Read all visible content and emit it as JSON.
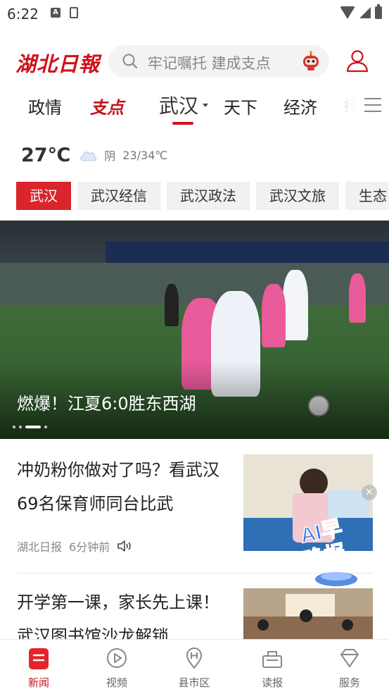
{
  "status_bar": {
    "time": "6:22"
  },
  "header": {
    "logo": "湖北日報",
    "search_placeholder": "牢记嘱托 建成支点"
  },
  "channels": {
    "items": [
      "政情",
      "支点",
      "武汉",
      "天下",
      "经济",
      "抖"
    ],
    "active": "武汉"
  },
  "weather": {
    "temperature": "27℃",
    "condition": "阴",
    "range": "23/34℃"
  },
  "subtabs": {
    "items": [
      "武汉",
      "武汉经信",
      "武汉政法",
      "武汉文旅",
      "生态"
    ],
    "active": "武汉"
  },
  "hero": {
    "title": "燃爆！江夏6:0胜东西湖",
    "slide_count": 4,
    "active_slide": 3
  },
  "news": [
    {
      "title": "冲奶粉你做对了吗？看武汉69名保育师同台比武",
      "source": "湖北日报",
      "time": "6分钟前"
    },
    {
      "title": "开学第一课，家长先上课！武汉图书馆沙龙解锁"
    }
  ],
  "ai_badge": {
    "text": "AI早晚报"
  },
  "tabbar": {
    "items": [
      "新闻",
      "视频",
      "县市区",
      "读报",
      "服务"
    ],
    "active": "新闻"
  },
  "colors": {
    "brand_red": "#d0111b"
  }
}
